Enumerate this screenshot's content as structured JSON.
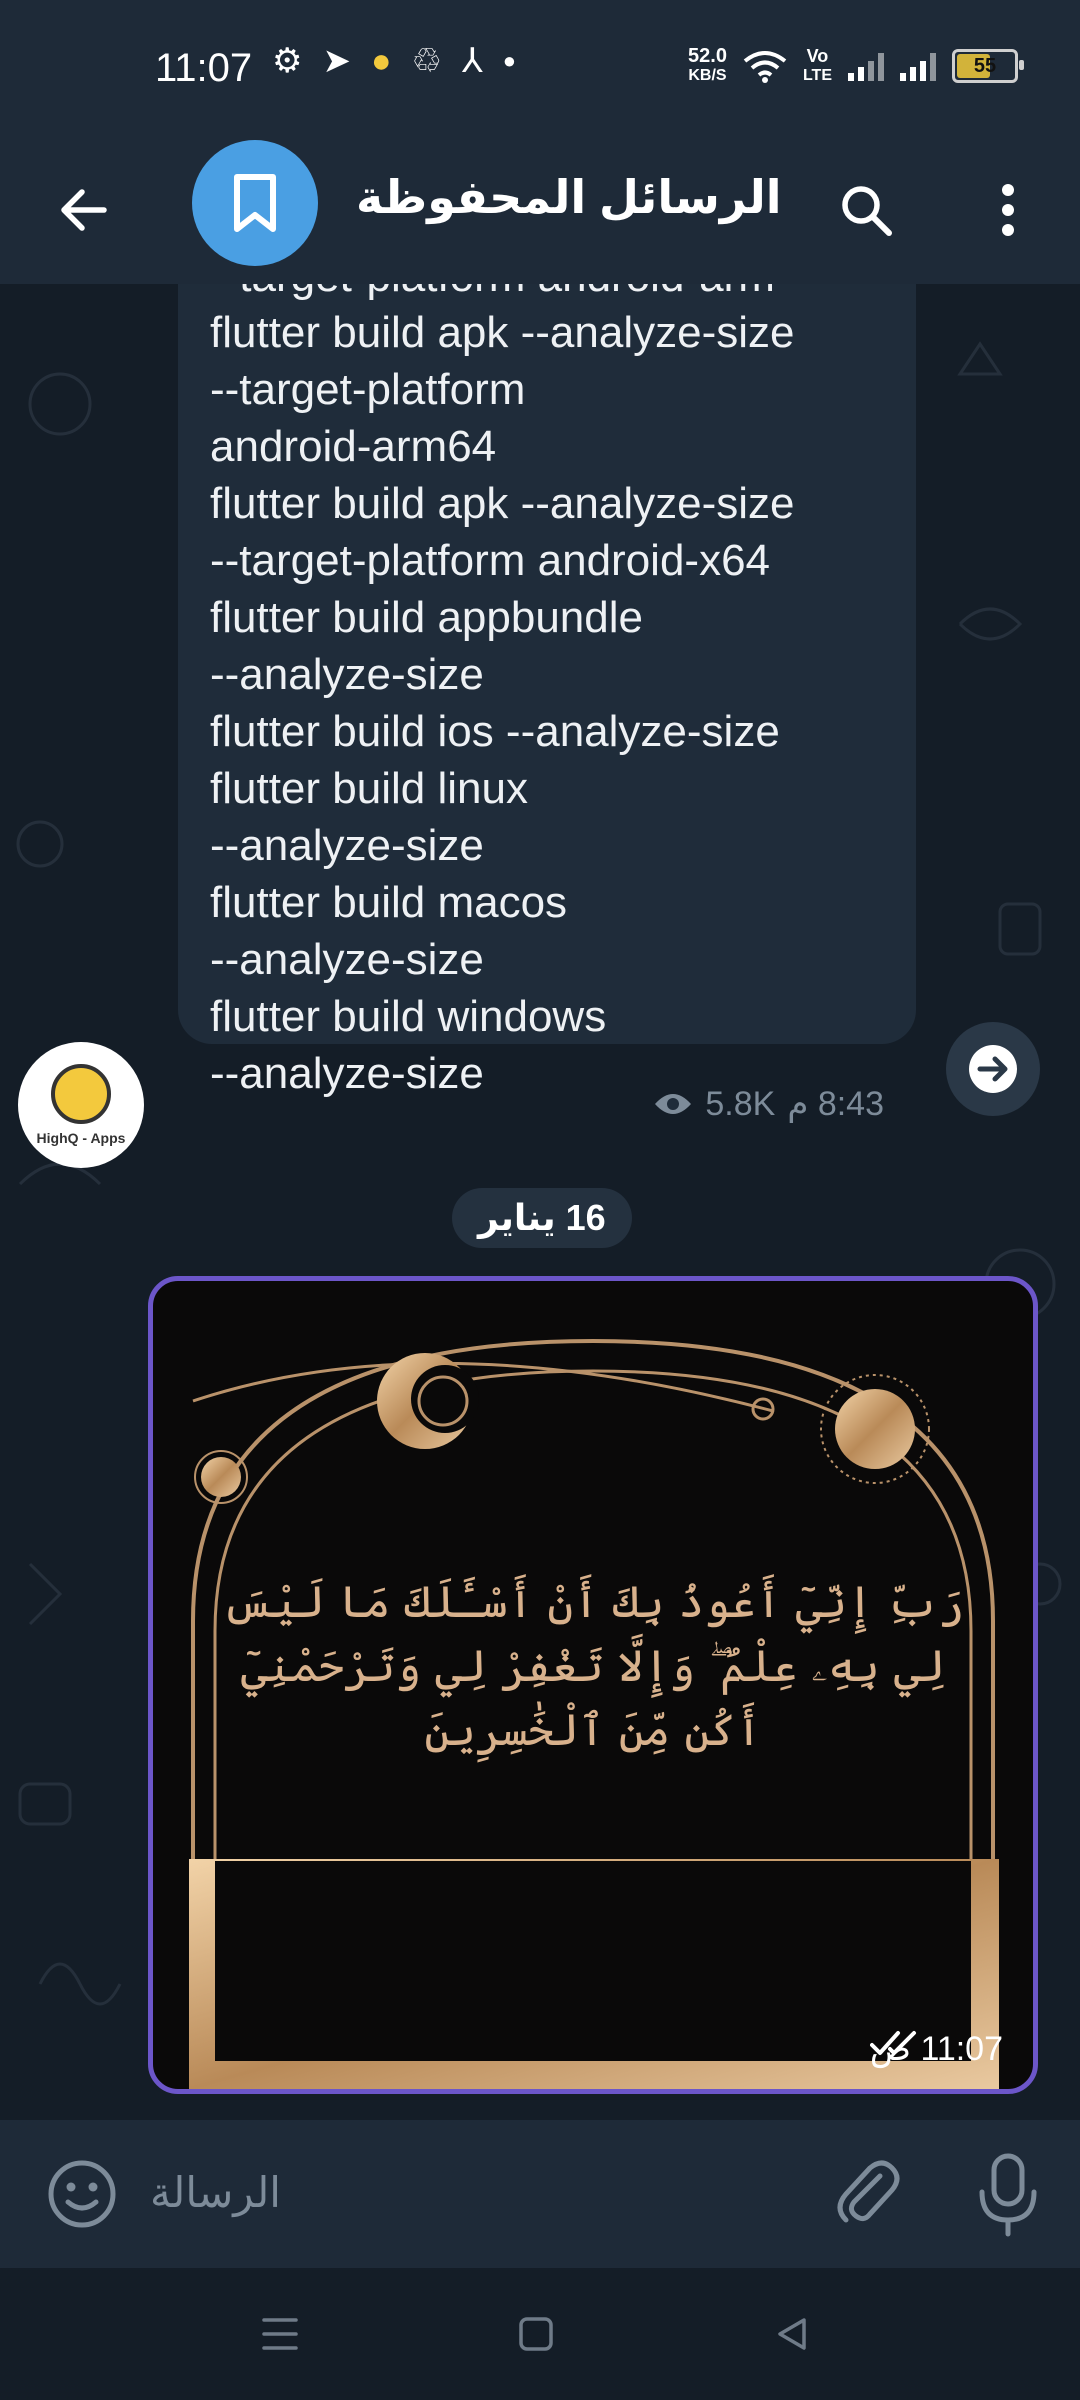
{
  "status_bar": {
    "time": "11:07",
    "net_speed_value": "52.0",
    "net_speed_unit": "KB/S",
    "volte_label_top": "Vo",
    "volte_label_bottom": "LTE",
    "battery_percent": "55",
    "icons": [
      "settings-icon",
      "telegram-icon",
      "coin-icon",
      "sync-icon",
      "pdf-icon",
      "dot-icon"
    ]
  },
  "header": {
    "title": "الرسائل المحفوظة",
    "icons": [
      "back-arrow-icon",
      "bookmark-icon",
      "search-icon",
      "more-vert-icon"
    ]
  },
  "messages": {
    "text_message": {
      "lines": [
        "--target-platform android-arm",
        "flutter build apk --analyze-size",
        "--target-platform",
        "android-arm64",
        "flutter build apk --analyze-size",
        "--target-platform android-x64",
        "flutter build appbundle",
        "--analyze-size",
        "flutter build ios --analyze-size",
        "flutter build linux",
        "--analyze-size",
        "flutter build macos",
        "--analyze-size",
        "flutter build windows",
        "--analyze-size"
      ],
      "views": "5.8K",
      "time": "8:43 م",
      "channel_logo_text": "HighQ - Apps"
    },
    "date_separator": "16 يناير",
    "image_message": {
      "dua_text": "رَبِّ إِنِّيٓ أَعُوذُ بِكَ أَنْ أَسْـَٔلَكَ مَا لَيْسَ لِي بِهِۦ عِلْمٌ ۖ وَإِلَّا تَغْفِرْ لِي وَتَرْحَمْنِيٓ أَكُن مِّنَ ٱلْخَٰسِرِينَ",
      "time": "11:07 ص"
    }
  },
  "input": {
    "placeholder": "الرسالة"
  },
  "colors": {
    "header_bg": "#1e2a38",
    "chat_bg": "#141d27",
    "bubble_bg": "#1f2c3a",
    "accent_blue": "#4a9fe3",
    "selection_border": "#6c56c9",
    "gold": "#d8b18c"
  }
}
